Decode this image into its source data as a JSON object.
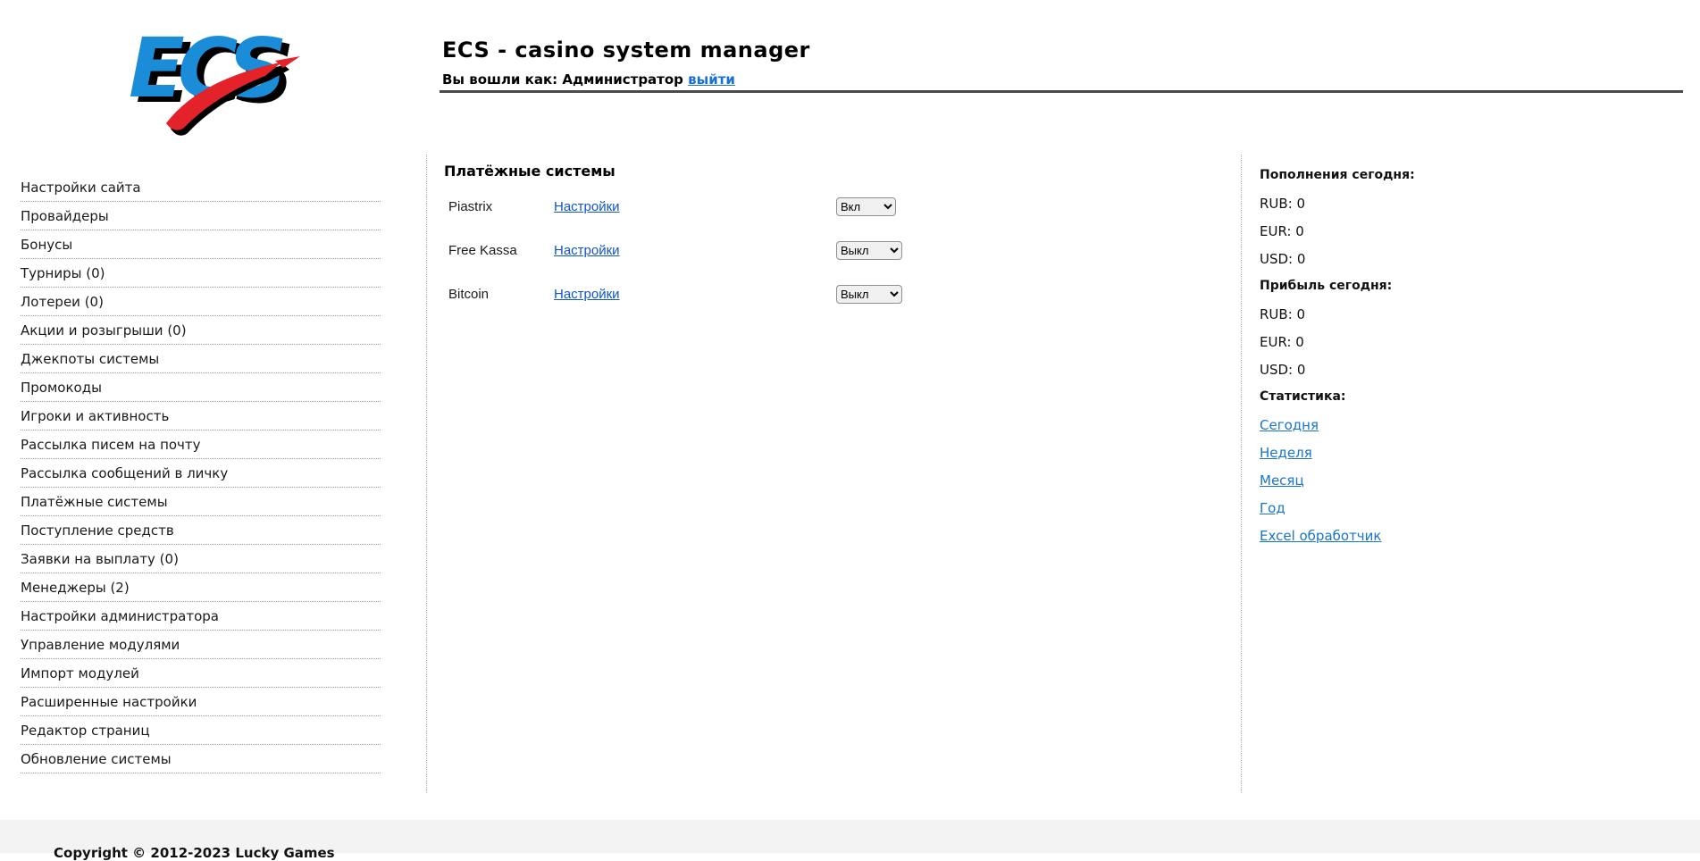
{
  "header": {
    "logo_text": "ECS",
    "title": "ECS - casino system manager",
    "login_prefix": "Вы вошли как: Администратор",
    "logout_link": "выйти"
  },
  "sidebar": {
    "items": [
      "Настройки сайта",
      "Провайдеры",
      "Бонусы",
      "Турниры (0)",
      "Лотереи (0)",
      "Акции и розыгрыши (0)",
      "Джекпоты системы",
      "Промокоды",
      "Игроки и активность",
      "Рассылка писем на почту",
      "Рассылка сообщений в личку",
      "Платёжные системы",
      "Поступление средств",
      "Заявки на выплату (0)",
      "Менеджеры (2)",
      "Настройки администратора",
      "Управление модулями",
      "Импорт модулей",
      "Расширенные настройки",
      "Редактор страниц",
      "Обновление системы"
    ]
  },
  "main": {
    "heading": "Платёжные системы",
    "rows": [
      {
        "name": "Piastrix",
        "settings_link": "Настройки",
        "status": "Вкл"
      },
      {
        "name": "Free Kassa",
        "settings_link": "Настройки",
        "status": "Выкл"
      },
      {
        "name": "Bitcoin",
        "settings_link": "Настройки",
        "status": "Выкл"
      }
    ]
  },
  "stats_panel": {
    "deposits_title": "Пополнения сегодня:",
    "deposits": {
      "rub": "RUB: 0",
      "eur": "EUR: 0",
      "usd": "USD: 0"
    },
    "profit_title": "Прибыль сегодня:",
    "profit": {
      "rub": "RUB: 0",
      "eur": "EUR: 0",
      "usd": "USD: 0"
    },
    "statistics_title": "Статистика:",
    "links": [
      "Сегодня",
      "Неделя",
      "Месяц",
      "Год",
      "Excel обработчик"
    ]
  },
  "footer": {
    "copyright": "Copyright © 2012-2023 Lucky Games"
  },
  "colors": {
    "logo_blue": "#1b8cd8",
    "logo_red": "#e32229",
    "link_blue": "#1155cc",
    "comic_link_blue": "#1874cd",
    "header_rule": "#4a4a4a",
    "footer_bg": "#f3f3f3"
  }
}
